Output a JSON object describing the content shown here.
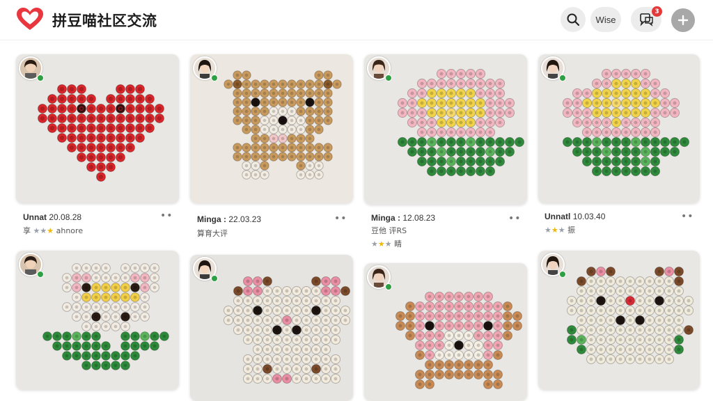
{
  "header": {
    "title": "拼豆喵社区交流",
    "search_icon": "search-icon",
    "text_button": "Wise",
    "message_icon": "message-icon",
    "notification_count": "3",
    "add_icon": "plus-icon",
    "accent": "#e8373e"
  },
  "posts": [
    {
      "title": "Heart bead art",
      "user": "Unnat",
      "date": "20.08.28",
      "sub": "享",
      "sub_extra": "ahnore",
      "rating": 3
    },
    {
      "title": "Bear bead art",
      "user": "Minga :",
      "date": "22.03.23",
      "sub": "算育大评",
      "sub_extra": "",
      "rating": 0
    },
    {
      "title": "Flower pot bead art",
      "user": "Minga :",
      "date": "12.08.23",
      "sub": "豆他 评RS",
      "sub_extra": "睛",
      "rating": 3
    },
    {
      "title": "Flower bead art",
      "user": "Unnatl",
      "date": "10.03.40",
      "sub": "",
      "sub_extra": "振",
      "rating": 3
    },
    {
      "title": "Flower bead art 2",
      "user": "",
      "date": "",
      "sub": "",
      "sub_extra": "",
      "rating": 0
    },
    {
      "title": "Cat bead art",
      "user": "",
      "date": "",
      "sub": "",
      "sub_extra": "",
      "rating": 0
    },
    {
      "title": "Puppy bead art",
      "user": "",
      "date": "",
      "sub": "",
      "sub_extra": "",
      "rating": 0
    },
    {
      "title": "Cat with flowers bead art",
      "user": "",
      "date": "",
      "sub": "",
      "sub_extra": "",
      "rating": 0
    }
  ],
  "more_icon": "more-dots-icon"
}
